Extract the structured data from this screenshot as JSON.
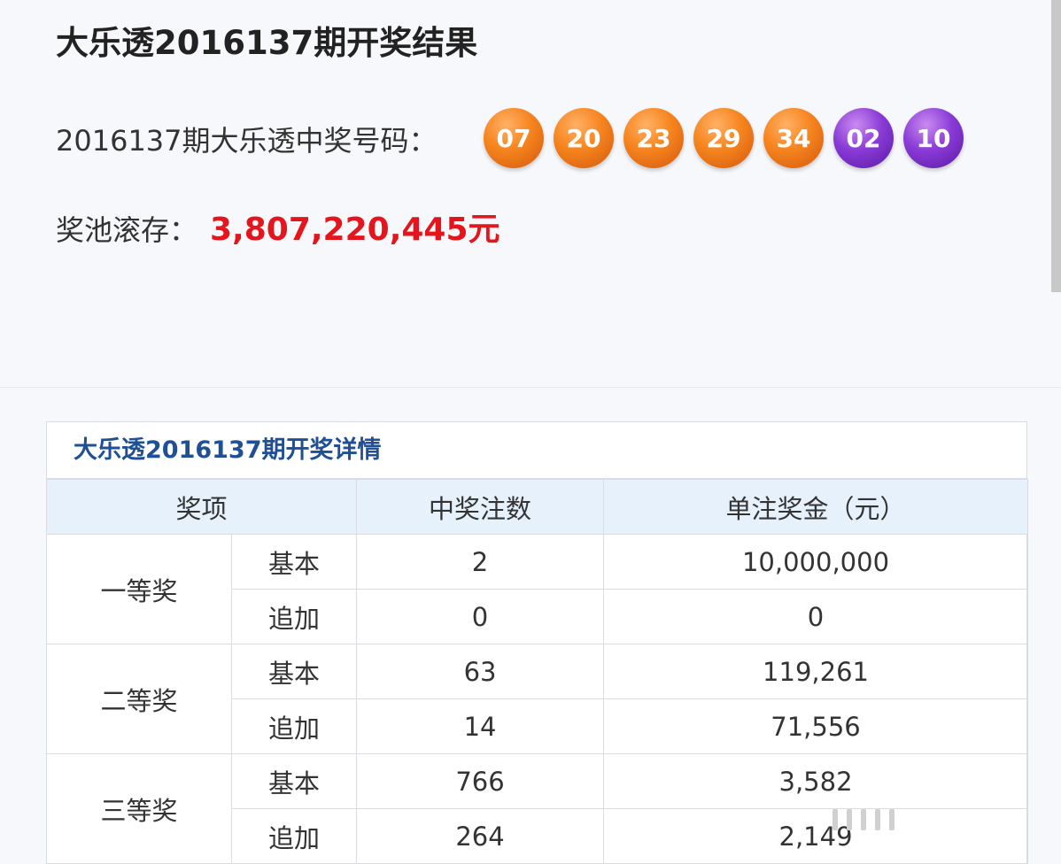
{
  "header": {
    "title": "大乐透2016137期开奖结果"
  },
  "draw": {
    "label": "2016137期大乐透中奖号码：",
    "front_balls": [
      "07",
      "20",
      "23",
      "29",
      "34"
    ],
    "back_balls": [
      "02",
      "10"
    ],
    "colors": {
      "front_ball": "#f7861f",
      "back_ball": "#8a3bd6"
    }
  },
  "pool": {
    "label": "奖池滚存：",
    "value": "3,807,220,445元",
    "color": "#e4151d"
  },
  "details": {
    "title": "大乐透2016137期开奖详情",
    "columns": [
      "奖项",
      "中奖注数",
      "单注奖金（元）"
    ],
    "rows": [
      {
        "prize": "一等奖",
        "type": "基本",
        "count": "2",
        "amount": "10,000,000"
      },
      {
        "prize": "",
        "type": "追加",
        "count": "0",
        "amount": "0"
      },
      {
        "prize": "二等奖",
        "type": "基本",
        "count": "63",
        "amount": "119,261"
      },
      {
        "prize": "",
        "type": "追加",
        "count": "14",
        "amount": "71,556"
      },
      {
        "prize": "三等奖",
        "type": "基本",
        "count": "766",
        "amount": "3,582"
      },
      {
        "prize": "",
        "type": "追加",
        "count": "264",
        "amount": "2,149"
      }
    ]
  }
}
